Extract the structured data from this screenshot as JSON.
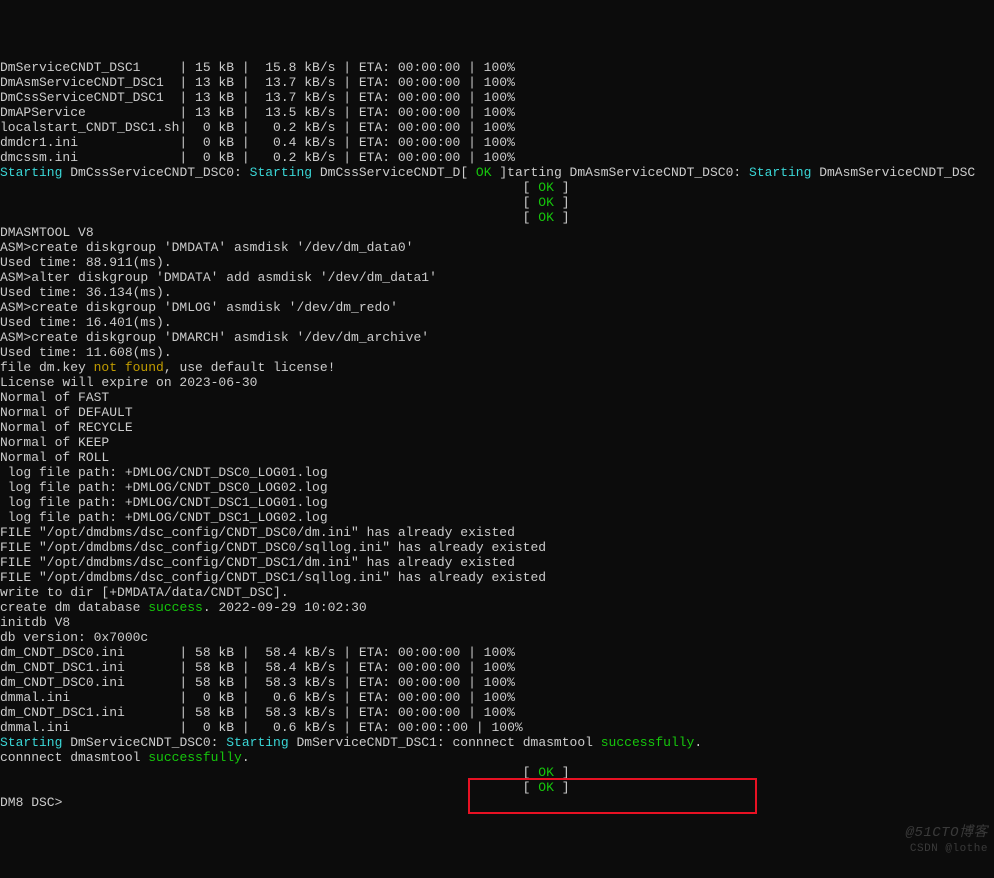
{
  "watermark1": "@51CTO博客",
  "watermark2": "CSDN @lothe",
  "transfers1": [
    {
      "name": "DmServiceCNDT_DSC1",
      "size": "15 kB",
      "rate": "15.8 kB/s",
      "eta": "00:00:00",
      "pct": "100%"
    },
    {
      "name": "DmAsmServiceCNDT_DSC1",
      "size": "13 kB",
      "rate": "13.7 kB/s",
      "eta": "00:00:00",
      "pct": "100%"
    },
    {
      "name": "DmCssServiceCNDT_DSC1",
      "size": "13 kB",
      "rate": "13.7 kB/s",
      "eta": "00:00:00",
      "pct": "100%"
    },
    {
      "name": "DmAPService",
      "size": "13 kB",
      "rate": "13.5 kB/s",
      "eta": "00:00:00",
      "pct": "100%"
    },
    {
      "name": "localstart_CNDT_DSC1.sh",
      "size": " 0 kB",
      "rate": " 0.2 kB/s",
      "eta": "00:00:00",
      "pct": "100%"
    },
    {
      "name": "dmdcr1.ini",
      "size": " 0 kB",
      "rate": " 0.4 kB/s",
      "eta": "00:00:00",
      "pct": "100%"
    },
    {
      "name": "dmcssm.ini",
      "size": " 0 kB",
      "rate": " 0.2 kB/s",
      "eta": "00:00:00",
      "pct": "100%"
    }
  ],
  "svc1": {
    "starting": "Starting",
    "svc1": "DmCssServiceCNDT_DSC0:",
    "svc1inner": "DmCssServiceCNDT_D",
    "tarting": "]tarting",
    "svc2": "DmAsmServiceCNDT_DSC0:",
    "svc2inner": "DmAsmServiceCNDT_DSC",
    "ok": "OK"
  },
  "tool_header": "DMASMTOOL V8",
  "asm": [
    {
      "cmd": "ASM>create diskgroup 'DMDATA' asmdisk '/dev/dm_data0'",
      "time": "Used time: 88.911(ms)."
    },
    {
      "cmd": "ASM>alter diskgroup 'DMDATA' add asmdisk '/dev/dm_data1'",
      "time": "Used time: 36.134(ms)."
    },
    {
      "cmd": "ASM>create diskgroup 'DMLOG' asmdisk '/dev/dm_redo'",
      "time": "Used time: 16.401(ms)."
    },
    {
      "cmd": "ASM>create diskgroup 'DMARCH' asmdisk '/dev/dm_archive'",
      "time": "Used time: 11.608(ms)."
    }
  ],
  "key_prefix": "file dm.key ",
  "key_warn": "not found",
  "key_suffix": ", use default license!",
  "license_expire": "License will expire on 2023-06-30",
  "normals": [
    "Normal of FAST",
    "Normal of DEFAULT",
    "Normal of RECYCLE",
    "Normal of KEEP",
    "Normal of ROLL"
  ],
  "logpaths": [
    " log file path: +DMLOG/CNDT_DSC0_LOG01.log",
    " log file path: +DMLOG/CNDT_DSC0_LOG02.log",
    " log file path: +DMLOG/CNDT_DSC1_LOG01.log",
    " log file path: +DMLOG/CNDT_DSC1_LOG02.log"
  ],
  "existed": [
    "FILE \"/opt/dmdbms/dsc_config/CNDT_DSC0/dm.ini\" has already existed",
    "FILE \"/opt/dmdbms/dsc_config/CNDT_DSC0/sqllog.ini\" has already existed",
    "FILE \"/opt/dmdbms/dsc_config/CNDT_DSC1/dm.ini\" has already existed",
    "FILE \"/opt/dmdbms/dsc_config/CNDT_DSC1/sqllog.ini\" has already existed"
  ],
  "writedir": "write to dir [+DMDATA/data/CNDT_DSC].",
  "create_prefix": "create dm database ",
  "create_success": "success",
  "create_suffix": ". 2022-09-29 10:02:30",
  "initdb": "initdb V8",
  "dbver": "db version: 0x7000c",
  "transfers2": [
    {
      "name": "dm_CNDT_DSC0.ini",
      "size": "58 kB",
      "rate": "58.4 kB/s",
      "eta": "00:00:00",
      "pct": "100%"
    },
    {
      "name": "dm_CNDT_DSC1.ini",
      "size": "58 kB",
      "rate": "58.4 kB/s",
      "eta": "00:00:00",
      "pct": "100%"
    },
    {
      "name": "dm_CNDT_DSC0.ini",
      "size": "58 kB",
      "rate": "58.3 kB/s",
      "eta": "00:00:00",
      "pct": "100%"
    },
    {
      "name": "dmmal.ini",
      "size": " 0 kB",
      "rate": " 0.6 kB/s",
      "eta": "00:00:00",
      "pct": "100%"
    },
    {
      "name": "dm_CNDT_DSC1.ini",
      "size": "58 kB",
      "rate": "58.3 kB/s",
      "eta": "00:00:00",
      "pct": "100%"
    },
    {
      "name": "dmmal.ini",
      "size": " 0 kB",
      "rate": " 0.6 kB/s",
      "eta": "00:00:"
    }
  ],
  "tail_pct": ":00 | 100%",
  "svc2": {
    "starting": "Starting",
    "svc1": "DmServiceCNDT_DSC0:",
    "svc2": "DmServiceCNDT_DSC1:",
    "conn_prefix": "connnect dmasmtool ",
    "conn_suffix": ".",
    "ok": "OK",
    "success": "successfully"
  },
  "prompt": "DM8 DSC>"
}
